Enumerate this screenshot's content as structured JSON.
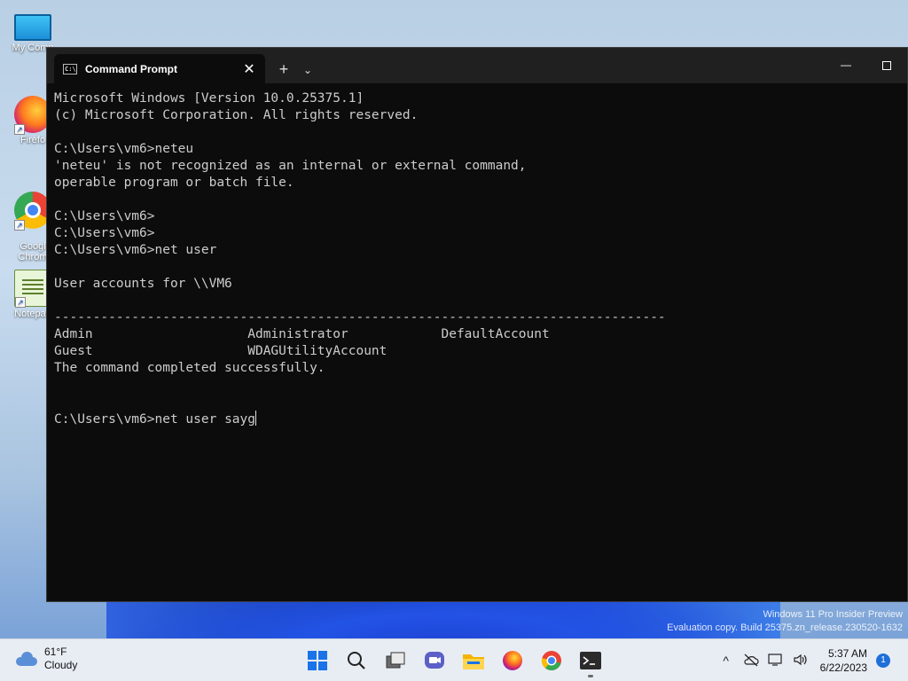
{
  "desktop": {
    "icons": [
      {
        "label": "My Comp",
        "icon": "computer-icon"
      },
      {
        "label": "Firefo",
        "icon": "firefox-icon"
      },
      {
        "label": "Googl\nChrom",
        "icon": "chrome-icon"
      },
      {
        "label": "Notepad",
        "icon": "notepad-icon"
      }
    ],
    "watermark_line1": "Windows 11 Pro Insider Preview",
    "watermark_line2": "Evaluation copy. Build 25375.zn_release.230520-1632"
  },
  "terminal": {
    "tab_title": "Command Prompt",
    "tab_icon_text": "C:\\",
    "close_tab": "✕",
    "new_tab": "+",
    "dropdown": "⌄",
    "minimize": "—",
    "lines": [
      "Microsoft Windows [Version 10.0.25375.1]",
      "(c) Microsoft Corporation. All rights reserved.",
      "",
      "C:\\Users\\vm6>neteu",
      "'neteu' is not recognized as an internal or external command,",
      "operable program or batch file.",
      "",
      "C:\\Users\\vm6>",
      "C:\\Users\\vm6>",
      "C:\\Users\\vm6>net user",
      "",
      "User accounts for \\\\VM6",
      "",
      "-------------------------------------------------------------------------------",
      "Admin                    Administrator            DefaultAccount",
      "Guest                    WDAGUtilityAccount",
      "The command completed successfully.",
      "",
      ""
    ],
    "current_prompt": "C:\\Users\\vm6>",
    "current_input": "net user sayg"
  },
  "taskbar": {
    "weather_temp": "61°F",
    "weather_cond": "Cloudy",
    "apps": [
      "start-icon",
      "search-icon",
      "task-view-icon",
      "chat-icon",
      "file-explorer-icon",
      "firefox-icon",
      "chrome-icon",
      "terminal-icon"
    ],
    "time": "5:37 AM",
    "date": "6/22/2023",
    "notification_count": "1"
  }
}
